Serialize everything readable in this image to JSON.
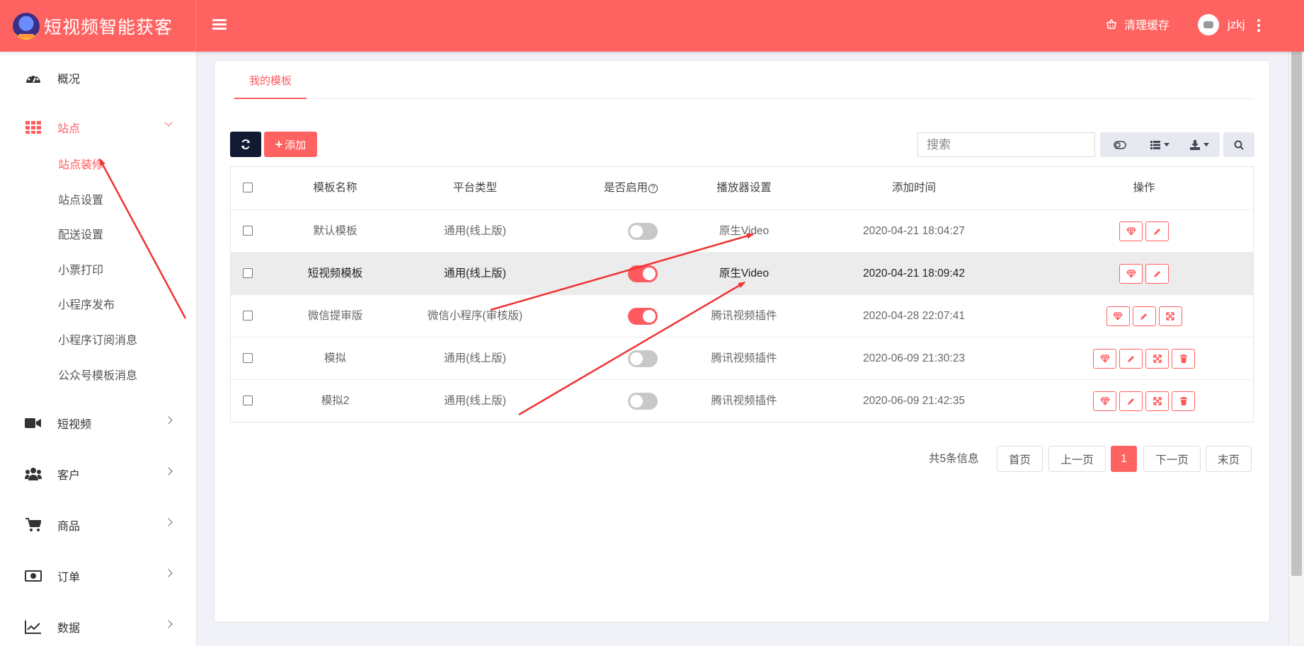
{
  "header": {
    "title": "短视频智能获客",
    "clear_cache": "清理缓存",
    "username": "jzkj"
  },
  "sidebar": {
    "items": [
      {
        "label": "概况",
        "icon": "dashboard-icon"
      },
      {
        "label": "站点",
        "icon": "grid-icon",
        "expanded": true
      },
      {
        "label": "短视频",
        "icon": "video-icon"
      },
      {
        "label": "客户",
        "icon": "users-icon"
      },
      {
        "label": "商品",
        "icon": "cart-icon"
      },
      {
        "label": "订单",
        "icon": "money-icon"
      },
      {
        "label": "数据",
        "icon": "chart-line-icon"
      }
    ],
    "sub_items": [
      "站点装修",
      "站点设置",
      "配送设置",
      "小票打印",
      "小程序发布",
      "小程序订阅消息",
      "公众号模板消息"
    ]
  },
  "main": {
    "tab": "我的模板",
    "add_button": "添加",
    "search_placeholder": "搜索",
    "table": {
      "headers": [
        "模板名称",
        "平台类型",
        "是否启用",
        "播放器设置",
        "添加时间",
        "操作"
      ],
      "rows": [
        {
          "name": "默认模板",
          "platform": "通用(线上版)",
          "enabled": false,
          "player": "原生Video",
          "time": "2020-04-21 18:04:27"
        },
        {
          "name": "短视频模板",
          "platform": "通用(线上版)",
          "enabled": true,
          "player": "原生Video",
          "time": "2020-04-21 18:09:42"
        },
        {
          "name": "微信提审版",
          "platform": "微信小程序(审核版)",
          "enabled": true,
          "player": "腾讯视频插件",
          "time": "2020-04-28 22:07:41"
        },
        {
          "name": "模拟",
          "platform": "通用(线上版)",
          "enabled": false,
          "player": "腾讯视频插件",
          "time": "2020-06-09 21:30:23"
        },
        {
          "name": "模拟2",
          "platform": "通用(线上版)",
          "enabled": false,
          "player": "腾讯视频插件",
          "time": "2020-06-09 21:42:35"
        }
      ]
    },
    "pagination": {
      "total": "共5条信息",
      "first": "首页",
      "prev": "上一页",
      "current": "1",
      "next": "下一页",
      "last": "末页"
    }
  },
  "colors": {
    "brand": "#ff6361",
    "dark_button": "#121a33",
    "annotation_arrow": "#ee3333"
  }
}
